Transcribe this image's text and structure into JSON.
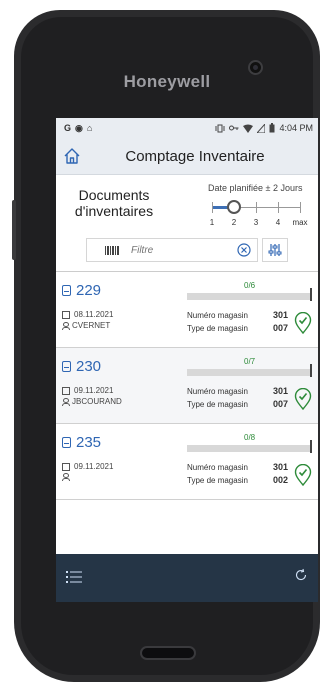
{
  "device": {
    "brand": "Honeywell"
  },
  "status_bar": {
    "left_icons": [
      "G",
      "◉",
      "⌂"
    ],
    "time": "4:04 PM"
  },
  "app_bar": {
    "title": "Comptage Inventaire",
    "home_icon": "home-icon"
  },
  "filters": {
    "documents_title_line1": "Documents",
    "documents_title_line2": "d'inventaires",
    "date_label": "Date planifiée ± 2 Jours",
    "slider_labels": [
      "1",
      "2",
      "3",
      "4",
      "max"
    ],
    "slider_value_index": 1
  },
  "search": {
    "placeholder": "Filtre",
    "value": ""
  },
  "documents": [
    {
      "number": "229",
      "date": "08.11.2021",
      "user": "CVERNET",
      "count": "0/6",
      "progress": 0,
      "store_label": "Numéro magasin",
      "store_value": "301",
      "type_label": "Type de magasin",
      "type_value": "007"
    },
    {
      "number": "230",
      "date": "09.11.2021",
      "user": "JBCOURAND",
      "count": "0/7",
      "progress": 0,
      "store_label": "Numéro magasin",
      "store_value": "301",
      "type_label": "Type de magasin",
      "type_value": "007"
    },
    {
      "number": "235",
      "date": "09.11.2021",
      "user": "",
      "count": "0/8",
      "progress": 0,
      "store_label": "Numéro magasin",
      "store_value": "301",
      "type_label": "Type de magasin",
      "type_value": "002"
    }
  ],
  "colors": {
    "accent": "#2f66b3",
    "success": "#2e8b3a",
    "bottom_bar": "#253546"
  }
}
